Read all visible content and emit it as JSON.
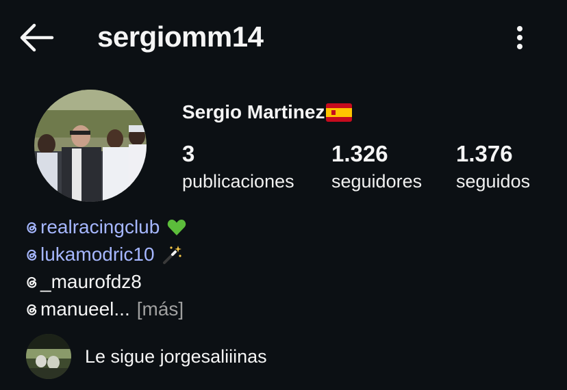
{
  "header": {
    "username": "sergiomm14",
    "back_icon": "arrow-left-icon",
    "more_icon": "more-vertical-icon"
  },
  "profile": {
    "display_name": "Sergio Martinez",
    "flag_icon": "spain-flag-icon",
    "stats": [
      {
        "count": "3",
        "label": "publicaciones"
      },
      {
        "count": "1.326",
        "label": "seguidores"
      },
      {
        "count": "1.376",
        "label": "seguidos"
      }
    ]
  },
  "bio": {
    "mentions": [
      {
        "handle": "realracingclub",
        "emoji": "green-heart-icon",
        "linked": true
      },
      {
        "handle": "lukamodric10",
        "emoji": "magic-wand-icon",
        "linked": true
      },
      {
        "handle": "_maurofdz8",
        "linked": false
      },
      {
        "handle": "manueel...",
        "linked": false
      }
    ],
    "more_label": "[más]"
  },
  "followed_by": {
    "text": "Le sigue jorgesaliiinas"
  },
  "colors": {
    "background": "#0c1014",
    "link": "#a6b7ff",
    "text": "#f5f5f5",
    "muted": "#a0a0a0"
  }
}
